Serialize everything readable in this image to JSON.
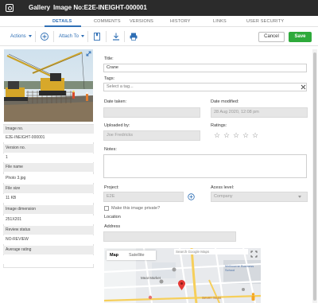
{
  "header": {
    "app": "Gallery",
    "image_title": "Image No:E2E-INEIGHT-000001"
  },
  "tabs": [
    {
      "label": "DETAILS"
    },
    {
      "label": "COMMENTS"
    },
    {
      "label": "VERSIONS"
    },
    {
      "label": "HISTORY"
    },
    {
      "label": "LINKS"
    },
    {
      "label": "USER SECURITY"
    }
  ],
  "toolbar": {
    "actions": "Actions",
    "attach_to": "Attach To",
    "cancel": "Cancel",
    "save": "Save"
  },
  "icons": {
    "logo": "gallery-logo-icon",
    "add": "plus-circle-icon",
    "bookmark": "bookmark-icon",
    "download": "download-icon",
    "print": "print-icon",
    "expand": "expand-icon",
    "clear": "close-icon",
    "star": "star-outline-icon",
    "caret": "caret-down-icon"
  },
  "metadata": [
    {
      "label": "Image no.",
      "value": "E2E-INEIGHT-000001"
    },
    {
      "label": "Version no.",
      "value": "1"
    },
    {
      "label": "File name",
      "value": "Photo 3.jpg"
    },
    {
      "label": "File size",
      "value": "11 KB"
    },
    {
      "label": "Image dimension",
      "value": "251X201"
    },
    {
      "label": "Review status",
      "value": "NO-REVIEW"
    },
    {
      "label": "Average rating",
      "value": ""
    }
  ],
  "form": {
    "title_label": "Title:",
    "title_value": "Crane",
    "tags_label": "Tags:",
    "tags_placeholder": "Select a tag...",
    "date_taken_label": "Date taken:",
    "date_modified_label": "Date modified:",
    "date_modified_value": "28 Aug 2020, 12:08 pm",
    "uploaded_by_label": "Uploaded by:",
    "uploaded_by_value": "Joe Fredricks",
    "ratings_label": "Ratings:",
    "ratings_value": 0,
    "rating_max": 5,
    "notes_label": "Notes:",
    "project_label": "Project:",
    "project_value": "E2E",
    "access_label": "Acess level:",
    "access_value": "Company",
    "private_label": "Make this image private?",
    "location_label": "Location",
    "address_label": "Address"
  },
  "map": {
    "map_tab": "Map",
    "satellite_tab": "Satellite",
    "search_text": "Search Google Maps",
    "labels": [
      "Melbourne Business School",
      "Seven Seas",
      "Meat Market"
    ]
  },
  "colors": {
    "accent": "#2f6fb5",
    "save": "#2eaa3b",
    "titlebar": "#2b2b2b"
  }
}
